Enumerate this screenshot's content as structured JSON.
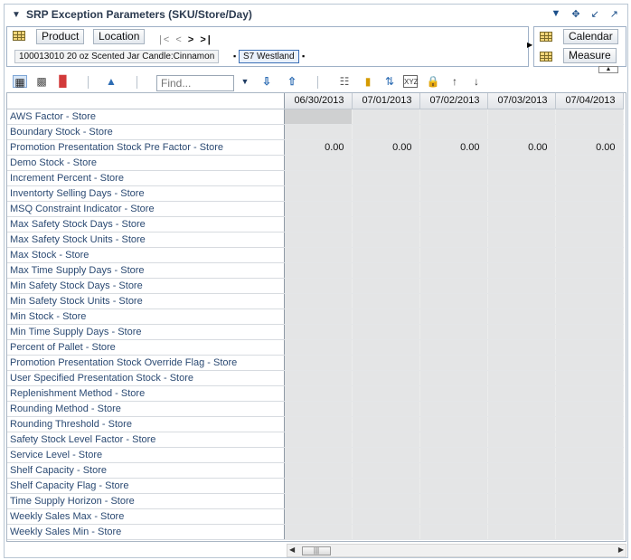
{
  "title": "SRP Exception Parameters (SKU/Store/Day)",
  "header": {
    "dimensions": [
      "Product",
      "Location"
    ],
    "right_dimensions": [
      "Calendar",
      "Measure"
    ],
    "members": [
      "100013010 20 oz Scented Jar Candle:Cinnamon",
      "S7 Westland"
    ]
  },
  "toolbar": {
    "find_placeholder": "Find..."
  },
  "columns": [
    "06/30/2013",
    "07/01/2013",
    "07/02/2013",
    "07/03/2013",
    "07/04/2013"
  ],
  "rows": [
    {
      "label": "AWS Factor - Store",
      "values": [
        "",
        "",
        "",
        "",
        ""
      ]
    },
    {
      "label": "Boundary Stock - Store",
      "values": [
        "",
        "",
        "",
        "",
        ""
      ]
    },
    {
      "label": "Promotion Presentation Stock Pre Factor - Store",
      "values": [
        "0.00",
        "0.00",
        "0.00",
        "0.00",
        "0.00"
      ]
    },
    {
      "label": "Demo Stock - Store",
      "values": [
        "",
        "",
        "",
        "",
        ""
      ]
    },
    {
      "label": "Increment Percent - Store",
      "values": [
        "",
        "",
        "",
        "",
        ""
      ]
    },
    {
      "label": "Inventorty Selling Days - Store",
      "values": [
        "",
        "",
        "",
        "",
        ""
      ]
    },
    {
      "label": "MSQ Constraint Indicator - Store",
      "values": [
        "",
        "",
        "",
        "",
        ""
      ]
    },
    {
      "label": "Max Safety Stock Days - Store",
      "values": [
        "",
        "",
        "",
        "",
        ""
      ]
    },
    {
      "label": "Max Safety Stock Units - Store",
      "values": [
        "",
        "",
        "",
        "",
        ""
      ]
    },
    {
      "label": "Max Stock - Store",
      "values": [
        "",
        "",
        "",
        "",
        ""
      ]
    },
    {
      "label": "Max Time Supply Days - Store",
      "values": [
        "",
        "",
        "",
        "",
        ""
      ]
    },
    {
      "label": "Min Safety Stock Days - Store",
      "values": [
        "",
        "",
        "",
        "",
        ""
      ]
    },
    {
      "label": "Min Safety Stock Units - Store",
      "values": [
        "",
        "",
        "",
        "",
        ""
      ]
    },
    {
      "label": "Min Stock - Store",
      "values": [
        "",
        "",
        "",
        "",
        ""
      ]
    },
    {
      "label": "Min Time Supply Days - Store",
      "values": [
        "",
        "",
        "",
        "",
        ""
      ]
    },
    {
      "label": "Percent of Pallet - Store",
      "values": [
        "",
        "",
        "",
        "",
        ""
      ]
    },
    {
      "label": "Promotion Presentation Stock Override Flag - Store",
      "values": [
        "",
        "",
        "",
        "",
        ""
      ]
    },
    {
      "label": "User Specified Presentation Stock - Store",
      "values": [
        "",
        "",
        "",
        "",
        ""
      ]
    },
    {
      "label": "Replenishment Method - Store",
      "values": [
        "",
        "",
        "",
        "",
        ""
      ]
    },
    {
      "label": "Rounding Method - Store",
      "values": [
        "",
        "",
        "",
        "",
        ""
      ]
    },
    {
      "label": "Rounding Threshold - Store",
      "values": [
        "",
        "",
        "",
        "",
        ""
      ]
    },
    {
      "label": "Safety Stock Level Factor - Store",
      "values": [
        "",
        "",
        "",
        "",
        ""
      ]
    },
    {
      "label": "Service Level - Store",
      "values": [
        "",
        "",
        "",
        "",
        ""
      ]
    },
    {
      "label": "Shelf Capacity - Store",
      "values": [
        "",
        "",
        "",
        "",
        ""
      ]
    },
    {
      "label": "Shelf Capacity Flag - Store",
      "values": [
        "",
        "",
        "",
        "",
        ""
      ]
    },
    {
      "label": "Time Supply Horizon - Store",
      "values": [
        "",
        "",
        "",
        "",
        ""
      ]
    },
    {
      "label": "Weekly Sales Max - Store",
      "values": [
        "",
        "",
        "",
        "",
        ""
      ]
    },
    {
      "label": "Weekly Sales Min - Store",
      "values": [
        "",
        "",
        "",
        "",
        ""
      ]
    }
  ]
}
